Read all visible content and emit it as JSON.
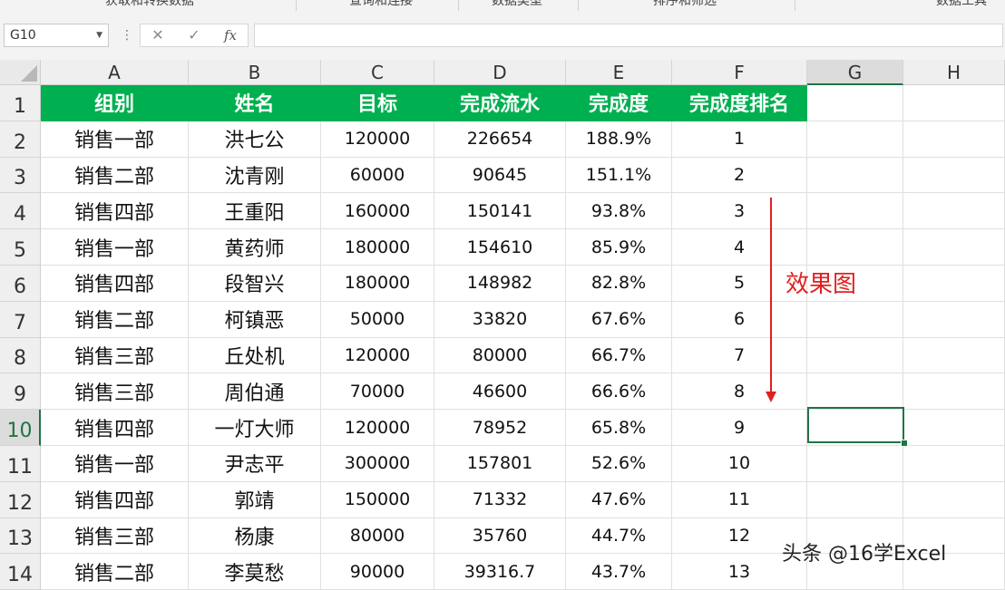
{
  "ribbon": {
    "groups": [
      "获取和转换数据",
      "查询和连接",
      "数据类型",
      "排序和筛选",
      "数据工具"
    ]
  },
  "formula_bar": {
    "name_box": "G10",
    "cancel_icon": "✕",
    "enter_icon": "✓",
    "fx_label": "fx",
    "formula": ""
  },
  "sheet": {
    "columns": [
      "A",
      "B",
      "C",
      "D",
      "E",
      "F",
      "G",
      "H"
    ],
    "active_column": "G",
    "active_row": 10,
    "header_row": [
      "组别",
      "姓名",
      "目标",
      "完成流水",
      "完成度",
      "完成度排名"
    ],
    "rows": [
      {
        "row": 2,
        "cells": [
          "销售一部",
          "洪七公",
          "120000",
          "226654",
          "188.9%",
          "1"
        ]
      },
      {
        "row": 3,
        "cells": [
          "销售二部",
          "沈青刚",
          "60000",
          "90645",
          "151.1%",
          "2"
        ]
      },
      {
        "row": 4,
        "cells": [
          "销售四部",
          "王重阳",
          "160000",
          "150141",
          "93.8%",
          "3"
        ]
      },
      {
        "row": 5,
        "cells": [
          "销售一部",
          "黄药师",
          "180000",
          "154610",
          "85.9%",
          "4"
        ]
      },
      {
        "row": 6,
        "cells": [
          "销售四部",
          "段智兴",
          "180000",
          "148982",
          "82.8%",
          "5"
        ]
      },
      {
        "row": 7,
        "cells": [
          "销售二部",
          "柯镇恶",
          "50000",
          "33820",
          "67.6%",
          "6"
        ]
      },
      {
        "row": 8,
        "cells": [
          "销售三部",
          "丘处机",
          "120000",
          "80000",
          "66.7%",
          "7"
        ]
      },
      {
        "row": 9,
        "cells": [
          "销售三部",
          "周伯通",
          "70000",
          "46600",
          "66.6%",
          "8"
        ]
      },
      {
        "row": 10,
        "cells": [
          "销售四部",
          "一灯大师",
          "120000",
          "78952",
          "65.8%",
          "9"
        ]
      },
      {
        "row": 11,
        "cells": [
          "销售一部",
          "尹志平",
          "300000",
          "157801",
          "52.6%",
          "10"
        ]
      },
      {
        "row": 12,
        "cells": [
          "销售四部",
          "郭靖",
          "150000",
          "71332",
          "47.6%",
          "11"
        ]
      },
      {
        "row": 13,
        "cells": [
          "销售三部",
          "杨康",
          "80000",
          "35760",
          "44.7%",
          "12"
        ]
      },
      {
        "row": 14,
        "cells": [
          "销售二部",
          "李莫愁",
          "90000",
          "39316.7",
          "43.7%",
          "13"
        ]
      }
    ]
  },
  "annotation": {
    "label": "效果图",
    "color": "#e02020"
  },
  "watermark": "头条 @16学Excel",
  "colors": {
    "header_fill": "#00b050",
    "selection": "#217346"
  }
}
